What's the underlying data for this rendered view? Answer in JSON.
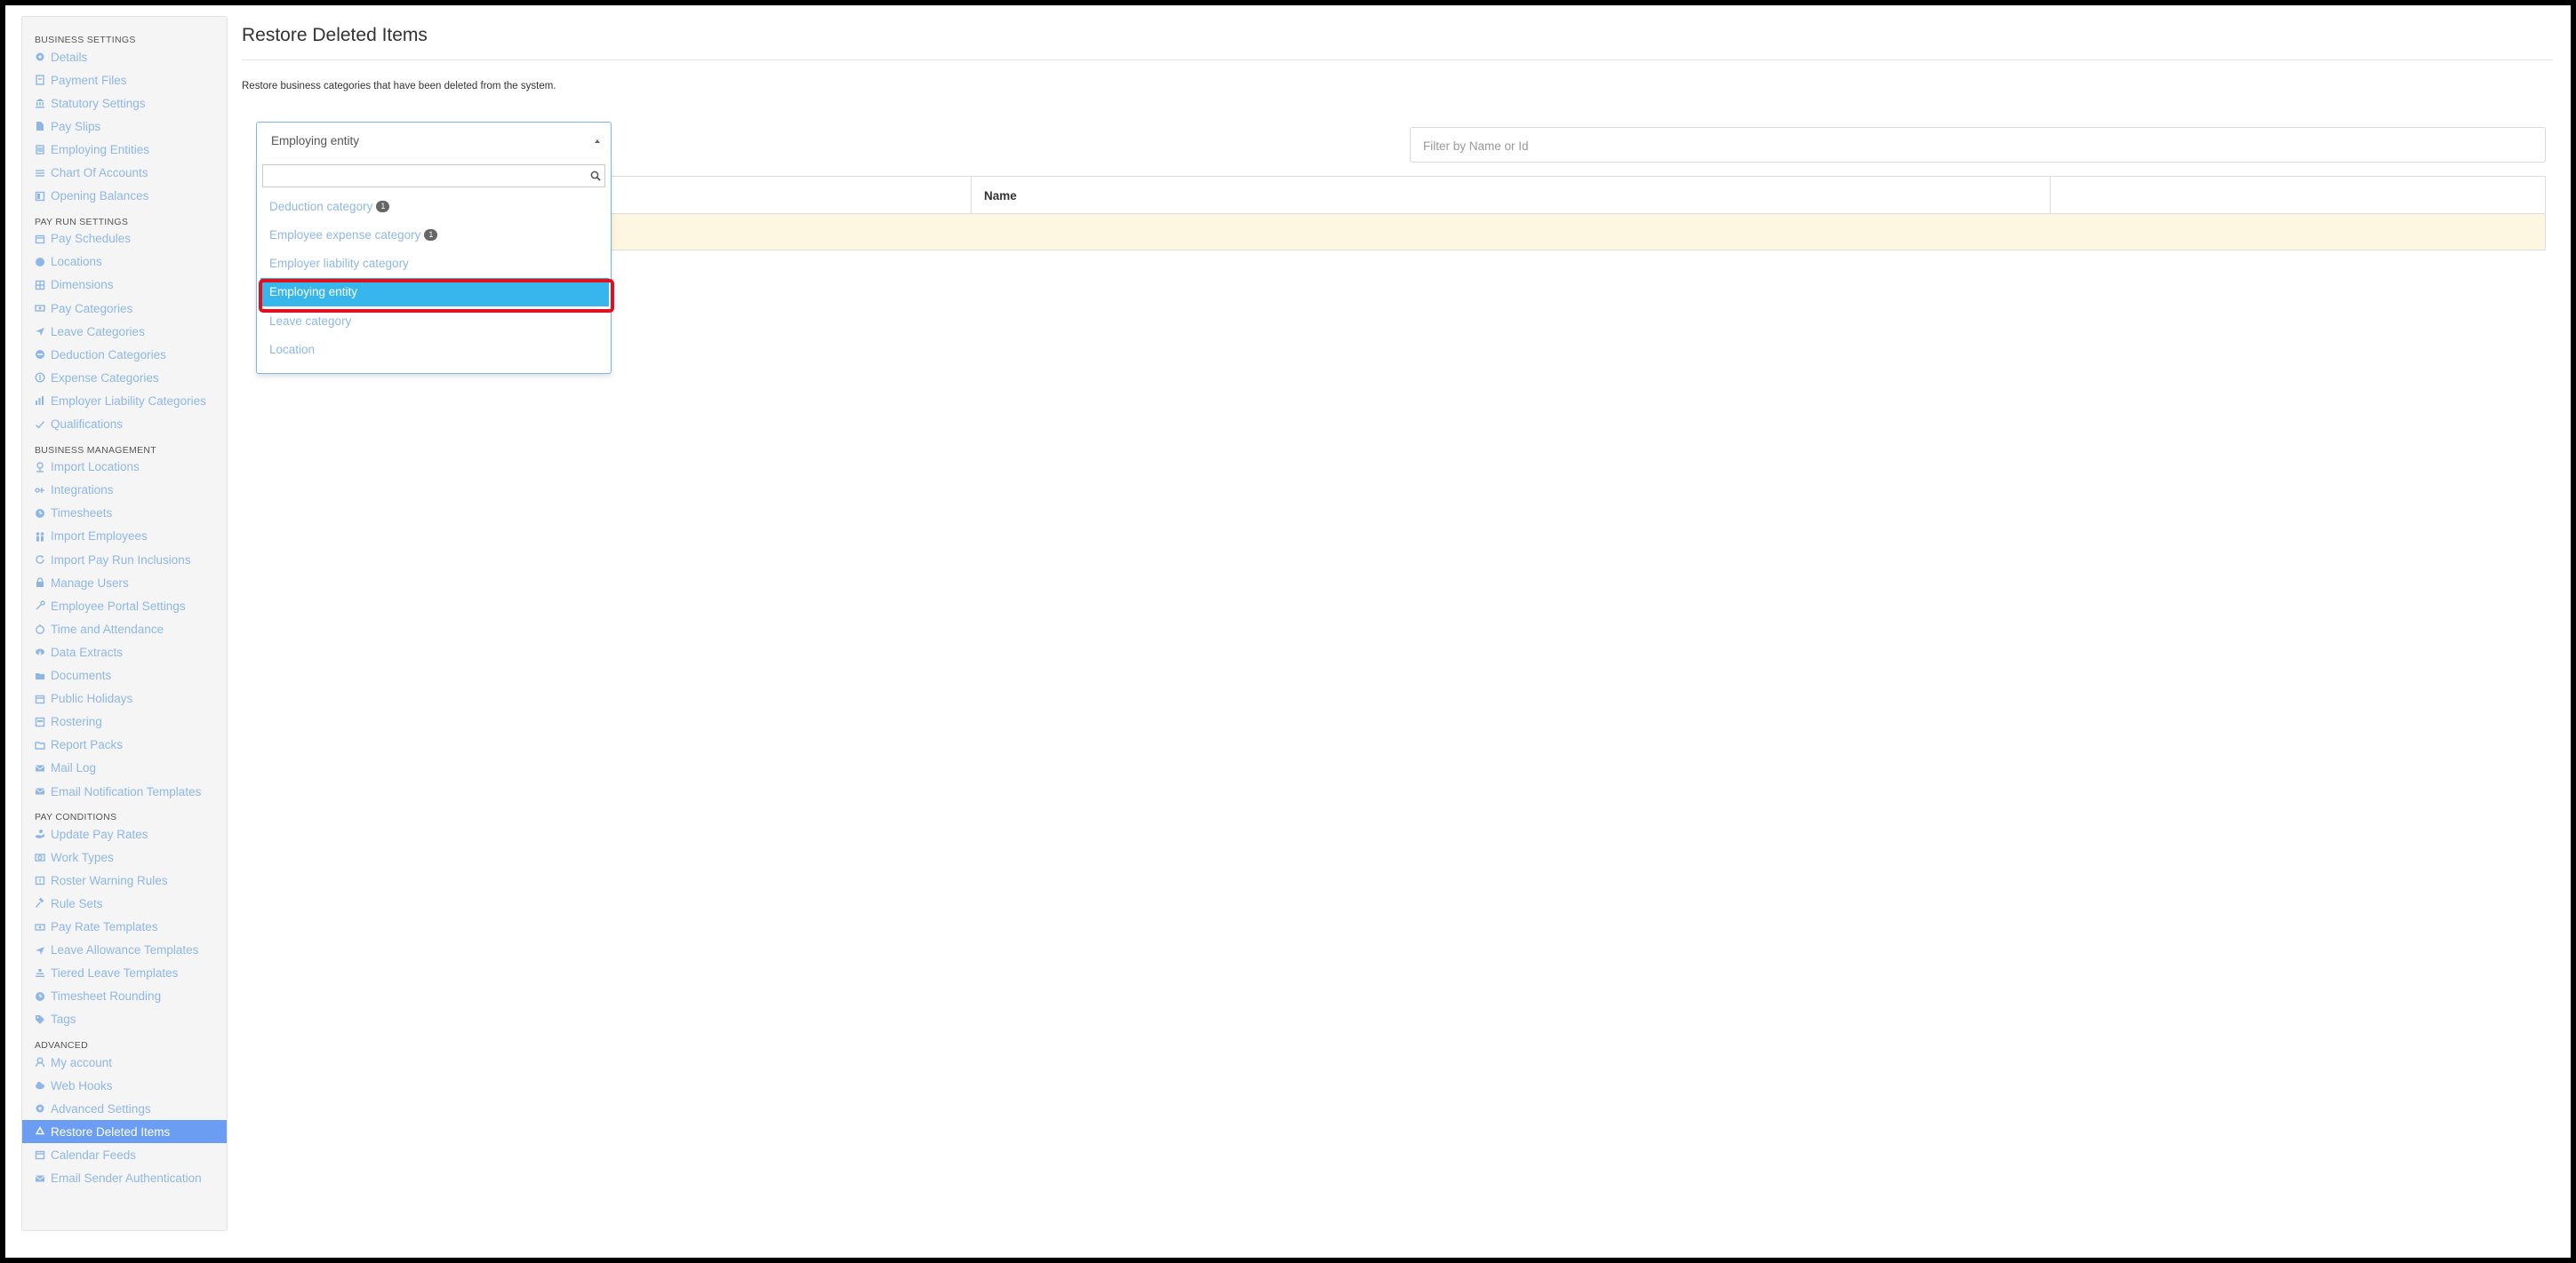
{
  "sidebar": {
    "sections": [
      {
        "header": "BUSINESS SETTINGS",
        "items": [
          {
            "label": "Details",
            "icon": "gear-icon"
          },
          {
            "label": "Payment Files",
            "icon": "file-icon"
          },
          {
            "label": "Statutory Settings",
            "icon": "bank-icon"
          },
          {
            "label": "Pay Slips",
            "icon": "document-icon"
          },
          {
            "label": "Employing Entities",
            "icon": "building-icon"
          },
          {
            "label": "Chart Of Accounts",
            "icon": "list-icon"
          },
          {
            "label": "Opening Balances",
            "icon": "ledger-icon"
          }
        ]
      },
      {
        "header": "PAY RUN SETTINGS",
        "items": [
          {
            "label": "Pay Schedules",
            "icon": "calendar-icon"
          },
          {
            "label": "Locations",
            "icon": "globe-icon"
          },
          {
            "label": "Dimensions",
            "icon": "grid-icon"
          },
          {
            "label": "Pay Categories",
            "icon": "money-icon"
          },
          {
            "label": "Leave Categories",
            "icon": "plane-icon"
          },
          {
            "label": "Deduction Categories",
            "icon": "minus-circle-icon"
          },
          {
            "label": "Expense Categories",
            "icon": "dollar-icon"
          },
          {
            "label": "Employer Liability Categories",
            "icon": "bar-chart-icon"
          },
          {
            "label": "Qualifications",
            "icon": "check-icon"
          }
        ]
      },
      {
        "header": "BUSINESS MANAGEMENT",
        "items": [
          {
            "label": "Import Locations",
            "icon": "pin-icon"
          },
          {
            "label": "Integrations",
            "icon": "plug-icon"
          },
          {
            "label": "Timesheets",
            "icon": "clock-icon"
          },
          {
            "label": "Import Employees",
            "icon": "users-icon"
          },
          {
            "label": "Import Pay Run Inclusions",
            "icon": "refresh-icon"
          },
          {
            "label": "Manage Users",
            "icon": "lock-icon"
          },
          {
            "label": "Employee Portal Settings",
            "icon": "wrench-icon"
          },
          {
            "label": "Time and Attendance",
            "icon": "stopwatch-icon"
          },
          {
            "label": "Data Extracts",
            "icon": "cloud-download-icon"
          },
          {
            "label": "Documents",
            "icon": "folder-icon"
          },
          {
            "label": "Public Holidays",
            "icon": "calendar-icon"
          },
          {
            "label": "Rostering",
            "icon": "roster-icon"
          },
          {
            "label": "Report Packs",
            "icon": "folder-open-icon"
          },
          {
            "label": "Mail Log",
            "icon": "envelope-icon"
          },
          {
            "label": "Email Notification Templates",
            "icon": "envelope-icon"
          }
        ]
      },
      {
        "header": "PAY CONDITIONS",
        "items": [
          {
            "label": "Update Pay Rates",
            "icon": "hand-money-icon"
          },
          {
            "label": "Work Types",
            "icon": "camera-icon"
          },
          {
            "label": "Roster Warning Rules",
            "icon": "calendar-alert-icon"
          },
          {
            "label": "Rule Sets",
            "icon": "gavel-icon"
          },
          {
            "label": "Pay Rate Templates",
            "icon": "money-icon"
          },
          {
            "label": "Leave Allowance Templates",
            "icon": "plane-icon"
          },
          {
            "label": "Tiered Leave Templates",
            "icon": "tier-icon"
          },
          {
            "label": "Timesheet Rounding",
            "icon": "clock-icon"
          },
          {
            "label": "Tags",
            "icon": "tag-icon"
          }
        ]
      },
      {
        "header": "ADVANCED",
        "items": [
          {
            "label": "My account",
            "icon": "user-icon"
          },
          {
            "label": "Web Hooks",
            "icon": "cloud-icon"
          },
          {
            "label": "Advanced Settings",
            "icon": "gear-icon"
          },
          {
            "label": "Restore Deleted Items",
            "icon": "recycle-icon",
            "active": true
          },
          {
            "label": "Calendar Feeds",
            "icon": "calendar-icon"
          },
          {
            "label": "Email Sender Authentication",
            "icon": "envelope-icon"
          }
        ]
      }
    ]
  },
  "main": {
    "title": "Restore Deleted Items",
    "description": "Restore business categories that have been deleted from the system.",
    "select": {
      "value": "Employing entity"
    },
    "dropdown": {
      "search_value": "",
      "options": [
        {
          "label": "Deduction category",
          "badge": "1"
        },
        {
          "label": "Employee expense category",
          "badge": "1"
        },
        {
          "label": "Employer liability category",
          "badge": ""
        },
        {
          "label": "Employing entity",
          "badge": "",
          "selected": true
        },
        {
          "label": "Leave category",
          "badge": ""
        },
        {
          "label": "Location",
          "badge": ""
        }
      ]
    },
    "filter": {
      "placeholder": "Filter by Name or Id",
      "value": ""
    },
    "grid": {
      "columns": [
        "",
        "Name",
        ""
      ]
    }
  },
  "colors": {
    "accent": "#6b9ef2",
    "link": "#8fb7e6",
    "selected_option": "#36b6ec",
    "highlight_ring": "#e0101e",
    "row_highlight": "#fdf6e0"
  }
}
